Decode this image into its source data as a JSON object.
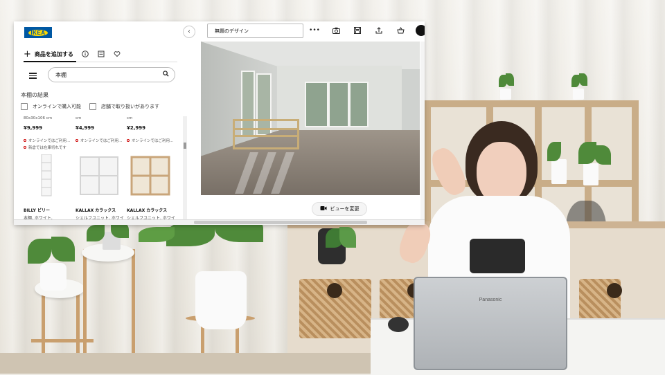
{
  "app": {
    "logo_text": "IKEA",
    "tabs": {
      "add_products": "商品を追加する"
    },
    "search": {
      "value": "本棚"
    },
    "results_title": "本棚の結果",
    "filters": [
      {
        "label": "オンラインで購入可能"
      },
      {
        "label": "店舗で取り扱いがあります"
      }
    ],
    "products": [
      {
        "dims": "80x30x106 cm",
        "price": "¥9,999",
        "availability": [
          "オンラインではご利用...",
          "新倉では在庫切れです"
        ],
        "name": "BILLY ビリー",
        "desc": "本棚, ホワイト,"
      },
      {
        "dims": "cm",
        "price": "¥4,999",
        "availability": [
          "オンラインではご利用..."
        ],
        "name": "KALLAX カラックス",
        "desc": "シェルフユニット, ホワイ"
      },
      {
        "dims": "cm",
        "price": "¥2,999",
        "availability": [
          "オンラインではご利用..."
        ],
        "name": "KALLAX カラックス",
        "desc": "シェルフユニット, ホワイ"
      }
    ],
    "design_name": "無題のデザイン",
    "change_view": "ビューを変更",
    "colors": {
      "ikea_blue": "#0058a3",
      "ikea_yellow": "#ffdb00",
      "alert_red": "#cc0000"
    }
  },
  "scene": {
    "laptop_brand": "Panasonic"
  }
}
